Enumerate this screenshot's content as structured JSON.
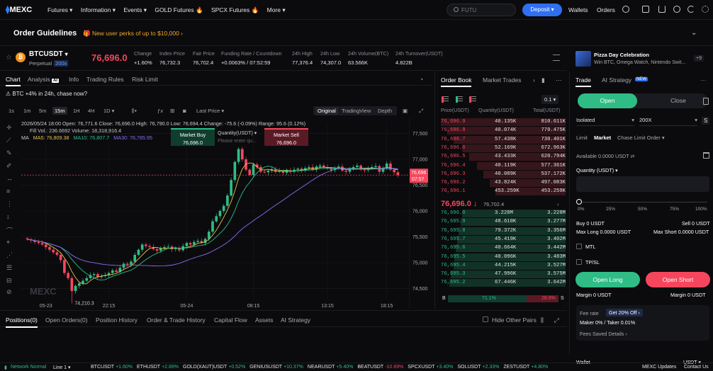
{
  "nav": {
    "logo": "MEXC",
    "menu": [
      "Futures ▾",
      "Information ▾",
      "Events ▾",
      "GOLD Futures 🔥",
      "SPCX Futures 🔥",
      "More ▾"
    ],
    "search_placeholder": "FUTU",
    "deposit": "Deposit ▾",
    "right_links": [
      "Wallets",
      "Orders"
    ]
  },
  "guide": {
    "title": "Order Guidelines",
    "promo": "🎁 New user perks of up to $10,000 ›"
  },
  "promo_card": {
    "title": "Pizza Day Celebration",
    "subtitle": "Win BTC, Omega Watch, Nintendo Swit...",
    "badge": "+9"
  },
  "ticker": {
    "symbol": "BTCUSDT",
    "type": "Perpetual",
    "leverage": "200x",
    "price": "76,696.0",
    "stats": [
      {
        "label": "Change",
        "value": "+1.60%",
        "color": "#2fbd85"
      },
      {
        "label": "Index Price",
        "value": "76,732.3"
      },
      {
        "label": "Fair Price",
        "value": "76,702.4"
      },
      {
        "label": "Funding Rate / Countdown",
        "value": "+0.0063% / 07:52:59"
      },
      {
        "label": "24h High",
        "value": "77,376.4"
      },
      {
        "label": "24h Low",
        "value": "74,307.0"
      },
      {
        "label": "24h Volume(BTC)",
        "value": "63.566K"
      },
      {
        "label": "24h Turnover(USDT)",
        "value": "4.822B"
      }
    ]
  },
  "chart_tabs": [
    "Chart",
    "Analysis",
    "Info",
    "Trading Rules",
    "Risk Limit"
  ],
  "analysis_badge": "AI",
  "chart_promo": "BTC +4% in 24h, chase now?",
  "toolbar": {
    "timeframes": [
      "1s",
      "1m",
      "5m",
      "15m",
      "1H",
      "4H",
      "1D ▾"
    ],
    "price_mode": "Last Price ▾",
    "views": [
      "Original",
      "TradingView",
      "Depth"
    ]
  },
  "legend": {
    "line1": "2026/05/24 18:00  Open: 76,771.6  Close: 76,696.0  High: 76,790.0  Low: 76,694.4  Change: -75.6 (-0.09%)  Range: 95.6 (0.12%)",
    "line2": "Fill Vol.: 236.6692  Volume: 18,318,916.4",
    "ma_label": "MA",
    "ma": [
      {
        "label": "MA5: 76,809.38",
        "color": "#e8c04a"
      },
      {
        "label": "MA10: 76,807.7",
        "color": "#2fbd85"
      },
      {
        "label": "MA30: 76,785.95",
        "color": "#8a6cf0"
      }
    ]
  },
  "market_widget": {
    "buy": "Market Buy",
    "buy_price": "76,696.0",
    "sell": "Market Sell",
    "sell_price": "76,696.0",
    "qty_label": "Quantity(USDT) ▾",
    "qty_placeholder": "Please enter qu..."
  },
  "chart_data": {
    "type": "candlestick",
    "title": "BTCUSDT Perpetual 15m",
    "x_ticks": [
      "05-23",
      "22:15",
      "05-24",
      "08:15",
      "13:15",
      "18:15"
    ],
    "y_ticks": [
      77500,
      77000,
      76500,
      76000,
      75500,
      75000,
      74500
    ],
    "ylim": [
      74300,
      77700
    ],
    "last_price": 76696,
    "last_price_label": "76,696",
    "countdown": "07:57",
    "low_marker": "74,210.3",
    "watermark": "MEXC",
    "candles_close": [
      75450,
      75430,
      75400,
      75380,
      75350,
      75300,
      75250,
      75200,
      75150,
      75050,
      74800,
      74700,
      74450,
      74550,
      74600,
      74650,
      74700,
      74760,
      74780,
      74720,
      74740,
      74760,
      74800,
      74850,
      74820,
      74900,
      74980,
      74960,
      75020,
      75150,
      75250,
      75350,
      75320,
      75300,
      75260,
      75230,
      75280,
      75300,
      75310,
      75260,
      75280,
      75240,
      75320,
      75380,
      75350,
      75400,
      75420,
      75380,
      75460,
      75600,
      75800,
      75900,
      76000,
      76100,
      76300,
      76600,
      76950,
      77200,
      77000,
      76800,
      76700,
      76900,
      76850,
      76760,
      76750,
      76780,
      76810,
      76760,
      76780,
      76740,
      76790,
      76760,
      76800,
      76820,
      76790,
      76830,
      76850,
      76800,
      76860,
      76880,
      76850,
      76820,
      76790,
      76830,
      76860,
      76780,
      76760,
      76820,
      76850,
      76880,
      76800,
      76790,
      76830,
      76850,
      76870,
      76760,
      76830,
      76920,
      76800,
      76750,
      76696
    ],
    "series": [
      {
        "name": "MA5",
        "color": "#e8c04a"
      },
      {
        "name": "MA10",
        "color": "#2fbd85"
      },
      {
        "name": "MA30",
        "color": "#8a6cf0"
      }
    ]
  },
  "orderbook": {
    "tabs": [
      "Order Book",
      "Market Trades"
    ],
    "step": "0.1 ▾",
    "headers": [
      "Price(USDT)",
      "Quantity(USDT)",
      "Total(USDT)"
    ],
    "asks": [
      [
        "76,696.9",
        "40.135K",
        "810.611K",
        1.0
      ],
      [
        "76,696.8",
        "40.074K",
        "770.475K",
        0.95
      ],
      [
        "76,696.7",
        "57.438K",
        "730.401K",
        0.9
      ],
      [
        "76,696.6",
        "52.169K",
        "672.963K",
        0.83
      ],
      [
        "76,696.5",
        "43.433K",
        "620.794K",
        0.77
      ],
      [
        "76,696.4",
        "40.119K",
        "577.361K",
        0.71
      ],
      [
        "76,696.3",
        "40.089K",
        "537.172K",
        0.66
      ],
      [
        "76,696.2",
        "43.824K",
        "497.083K",
        0.61
      ],
      [
        "76,696.1",
        "453.259K",
        "453.259K",
        0.56
      ]
    ],
    "mid_price": "76,696.0 ↓",
    "mid_mark": "76,702.4",
    "bids": [
      [
        "76,696.0",
        "3.228M",
        "3.228M",
        0.83
      ],
      [
        "76,695.9",
        "48.610K",
        "3.277M",
        0.84
      ],
      [
        "76,695.8",
        "79.372K",
        "3.356M",
        0.86
      ],
      [
        "76,695.7",
        "45.419K",
        "3.402M",
        0.87
      ],
      [
        "76,695.6",
        "40.664K",
        "3.442M",
        0.88
      ],
      [
        "76,695.5",
        "40.096K",
        "3.483M",
        0.89
      ],
      [
        "76,695.4",
        "44.215K",
        "3.527M",
        0.9
      ],
      [
        "76,695.3",
        "47.996K",
        "3.575M",
        0.92
      ],
      [
        "76,695.2",
        "67.446K",
        "3.642M",
        0.93
      ]
    ],
    "buy_pct_label": "71.1%",
    "sell_pct_label": "28.9%",
    "buy_ratio": 0.711,
    "b_label": "B",
    "s_label": "S"
  },
  "trade": {
    "tabs": [
      "Trade",
      "AI Strategy"
    ],
    "new_badge": "NEW",
    "open": "Open",
    "close": "Close",
    "margin_mode": "Isolated",
    "leverage": "200X",
    "order_types": [
      "Limit",
      "Market",
      "Chase Limit Order ▾"
    ],
    "available": "Available 0.0000 USDT ⇄",
    "qty_label": "Quantity (USDT) ▾",
    "slider_marks": [
      "0%",
      "25%",
      "50%",
      "75%",
      "100%"
    ],
    "buy": "Buy 0 USDT",
    "sell": "Sell 0 USDT",
    "max_long": "Max Long 0.0000 USDT",
    "max_short": "Max Short 0.0000 USDT",
    "mtl": "MTL",
    "tpsl": "TP/SL",
    "open_long": "Open Long",
    "open_short": "Open Short",
    "margin_left": "Margin 0 USDT",
    "margin_right": "Margin 0 USDT",
    "fee_rate": "Fee rate",
    "fee_promo": "Get 20% Off ›",
    "fee_value": "Maker 0% / Taker 0.01%",
    "fees_saved": "Fees Saved Details ›",
    "wallet": "Wallet",
    "wallet_unit": "USDT ▾"
  },
  "positions": {
    "tabs": [
      "Positions(0)",
      "Open Orders(0)",
      "Position History",
      "Order & Trade History",
      "Capital Flow",
      "Assets",
      "AI Strategy"
    ],
    "hide_label": "Hide Other Pairs"
  },
  "bottom": {
    "network": "Network Normal",
    "line": "Line 1 ▾",
    "items": [
      {
        "sym": "BTCUSDT",
        "chg": "+1.60%",
        "up": true
      },
      {
        "sym": "ETHUSDT",
        "chg": "+2.89%",
        "up": true
      },
      {
        "sym": "GOLD(XAUT)USDT",
        "chg": "+0.52%",
        "up": true
      },
      {
        "sym": "GENIUSUSDT",
        "chg": "+10.37%",
        "up": true
      },
      {
        "sym": "NEARUSDT",
        "chg": "+5.40%",
        "up": true
      },
      {
        "sym": "BEATUSDT",
        "chg": "-10.69%",
        "up": false
      },
      {
        "sym": "SPCXUSDT",
        "chg": "+3.40%",
        "up": true
      },
      {
        "sym": "SOLUSDT",
        "chg": "+2.33%",
        "up": true
      },
      {
        "sym": "ZESTUSDT",
        "chg": "+4.80%",
        "up": true
      }
    ],
    "updates": "MEXC Updates",
    "contact": "Contact Us"
  }
}
